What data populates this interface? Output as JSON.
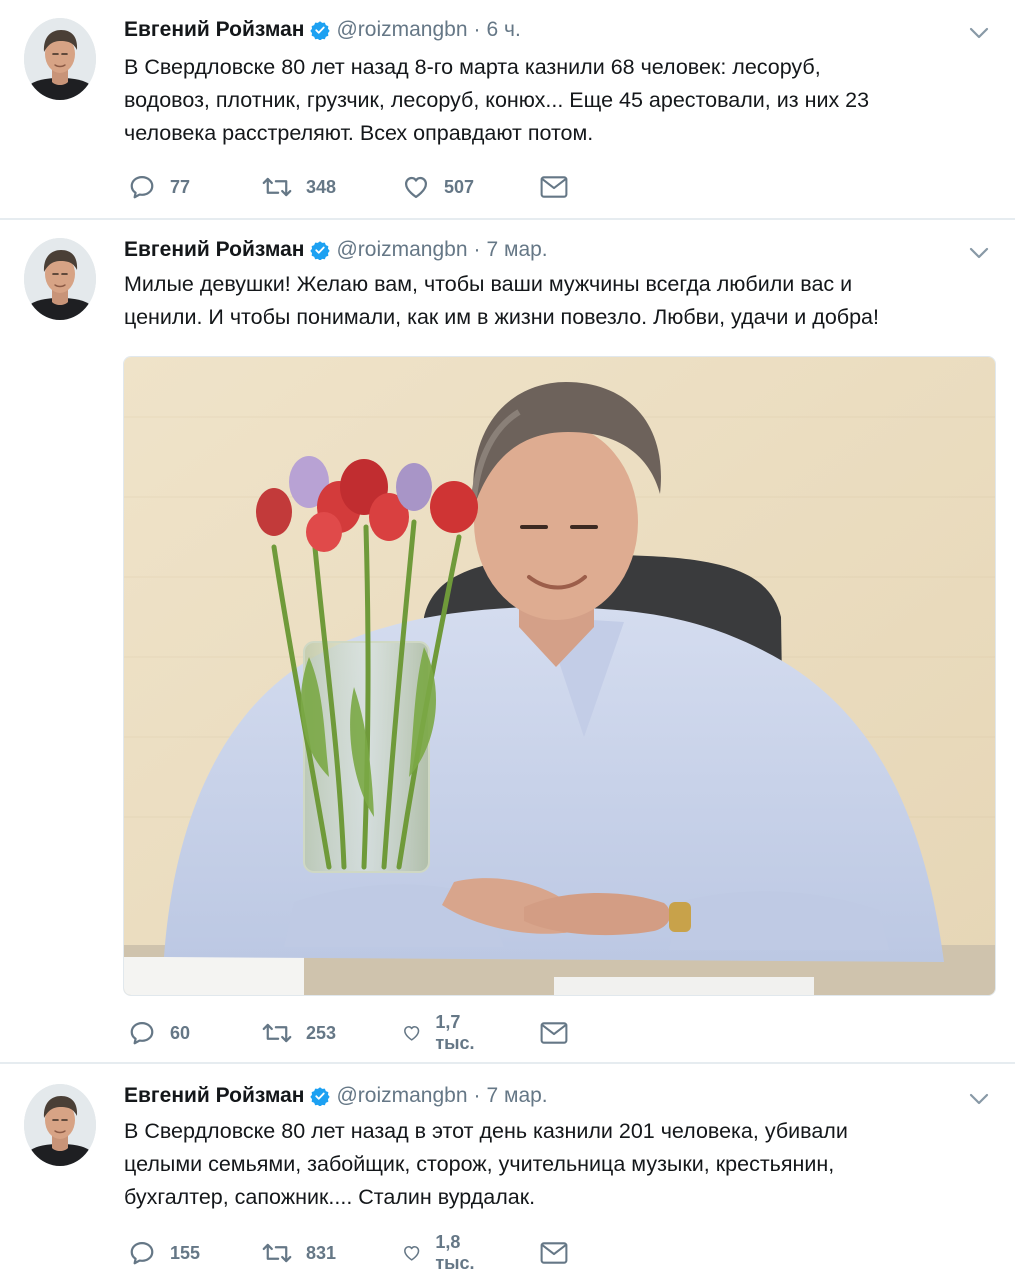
{
  "colors": {
    "text": "#14171a",
    "secondary": "#657786",
    "verified": "#1da1f2",
    "divider": "#e6ecf0"
  },
  "tweets": [
    {
      "author_name": "Евгений Ройзман",
      "handle": "@roizmangbn",
      "separator": "·",
      "time": "6 ч.",
      "text_lines": [
        "В Свердловске 80 лет назад 8-го марта казнили 68 человек: лесоруб,",
        "водовоз, плотник, грузчик, лесоруб, конюх... Еще 45 арестовали, из них 23",
        "человека расстреляют. Всех оправдают потом."
      ],
      "replies": "77",
      "retweets": "348",
      "likes": "507",
      "icons": [
        "reply-icon",
        "retweet-icon",
        "like-icon",
        "message-icon"
      ]
    },
    {
      "author_name": "Евгений Ройзман",
      "handle": "@roizmangbn",
      "separator": "·",
      "time": "7 мар.",
      "text_lines": [
        "Милые девушки!  Желаю вам, чтобы ваши мужчины всегда любили вас и",
        "ценили. И чтобы понимали, как им в жизни повезло.  Любви, удачи и добра!"
      ],
      "has_photo": true,
      "replies": "60",
      "retweets": "253",
      "likes": "1,7 тыс.",
      "icons": [
        "reply-icon",
        "retweet-icon",
        "like-icon",
        "message-icon"
      ]
    },
    {
      "author_name": "Евгений Ройзман",
      "handle": "@roizmangbn",
      "separator": "·",
      "time": "7 мар.",
      "text_lines": [
        "В Свердловске 80 лет назад в этот день казнили 201 человека, убивали",
        "целыми семьями, забойщик, сторож, учительница музыки, крестьянин,",
        "бухгалтер, сапожник.... Сталин вурдалак."
      ],
      "replies": "155",
      "retweets": "831",
      "likes": "1,8 тыс.",
      "icons": [
        "reply-icon",
        "retweet-icon",
        "like-icon",
        "message-icon"
      ]
    }
  ]
}
